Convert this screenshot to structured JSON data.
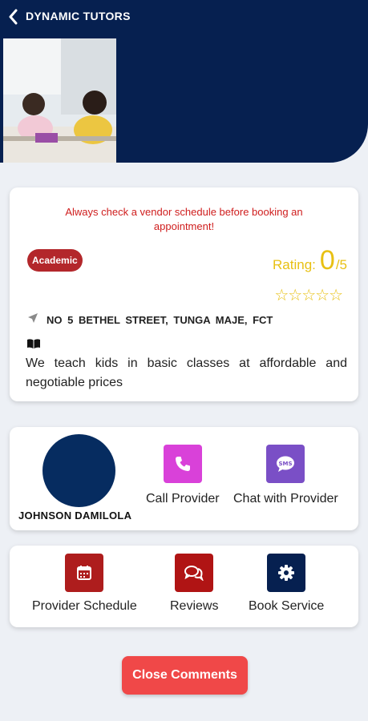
{
  "header": {
    "title": "DYNAMIC TUTORS"
  },
  "info": {
    "warning": "Always check a vendor schedule before booking an appointment!",
    "category": "Academic",
    "rating_label": "Rating:",
    "rating_value": "0",
    "rating_max": "/5",
    "stars": "☆☆☆☆☆",
    "address": "NO 5 BETHEL STREET, TUNGA MAJE, FCT",
    "description": "We teach kids in basic classes at affordable and negotiable prices"
  },
  "provider": {
    "name": "JOHNSON DAMILOLA",
    "call_label": "Call Provider",
    "chat_label": "Chat with Provider"
  },
  "actions": {
    "schedule_label": "Provider Schedule",
    "reviews_label": "Reviews",
    "book_label": "Book Service"
  },
  "close_label": "Close Comments",
  "colors": {
    "header": "#062050",
    "accent_red": "#b3272b",
    "call": "#d941d9",
    "chat": "#7a4fc6",
    "schedule": "#ae1d1d",
    "reviews": "#b01414",
    "book": "#062050",
    "close": "#f04848",
    "rating": "#e8c013"
  }
}
